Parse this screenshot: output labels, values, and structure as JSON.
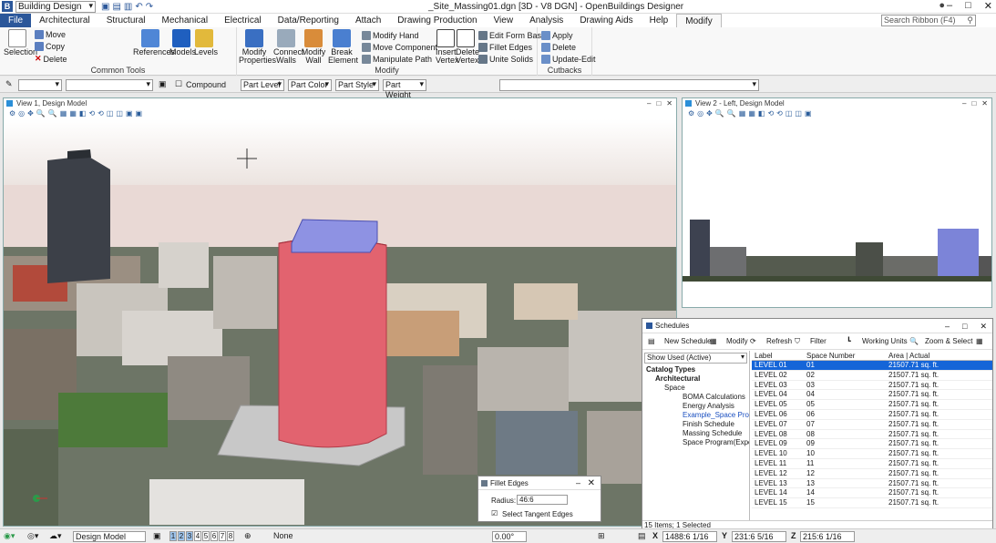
{
  "workspace": "Building Design",
  "title": "_Site_Massing01.dgn [3D - V8 DGN] - OpenBuildings Designer",
  "search_ribbon_placeholder": "Search Ribbon (F4)",
  "tabs": [
    "File",
    "Architectural",
    "Structural",
    "Mechanical",
    "Electrical",
    "Data/Reporting",
    "Attach",
    "Drawing Production",
    "View",
    "Analysis",
    "Drawing Aids",
    "Help",
    "Modify"
  ],
  "ribbon": {
    "common_tools": {
      "label": "Common Tools",
      "selection": "Selection",
      "move": "Move",
      "copy": "Copy",
      "delete": "Delete",
      "references": "References",
      "models": "Models",
      "levels": "Levels"
    },
    "modify": {
      "label": "Modify",
      "modify_properties": "Modify Properties",
      "connect_walls": "Connect Walls",
      "modify_wall": "Modify Wall",
      "break_element": "Break Element",
      "modify_hand": "Modify Hand",
      "move_component": "Move Component",
      "manipulate_path": "Manipulate Path",
      "insert_vertex": "Insert Vertex",
      "delete_vertex": "Delete Vertex",
      "edit_form_base": "Edit Form Base",
      "fillet_edges": "Fillet Edges",
      "unite_solids": "Unite Solids"
    },
    "cutbacks": {
      "label": "Cutbacks",
      "apply": "Apply",
      "delete": "Delete",
      "update_edit": "Update-Edit"
    }
  },
  "attr": {
    "compound": "Compound",
    "part_level": "Part Level",
    "part_color": "Part Color",
    "part_style": "Part Style",
    "part_weight": "Part Weight"
  },
  "view1": {
    "title": "View 1, Design Model"
  },
  "view2": {
    "title": "View 2 - Left, Design Model"
  },
  "schedules": {
    "title": "Schedules",
    "toolbar": {
      "new_schedule": "New Schedule",
      "modify": "Modify",
      "refresh": "Refresh",
      "filter": "Filter",
      "working_units": "Working Units",
      "zoom_select": "Zoom & Select"
    },
    "show_used": "Show Used (Active)",
    "tree": [
      "Catalog Types",
      "Architectural",
      "Space",
      "BOMA Calculations",
      "Energy Analysis",
      "Example_Space Proc",
      "Finish Schedule",
      "Massing Schedule",
      "Space Program(Expo"
    ],
    "columns": {
      "label": "Label",
      "space_number": "Space Number",
      "area": "Area | Actual"
    },
    "rows": [
      {
        "label": "LEVEL 01",
        "num": "01",
        "area": "21507.71 sq. ft."
      },
      {
        "label": "LEVEL 02",
        "num": "02",
        "area": "21507.71 sq. ft."
      },
      {
        "label": "LEVEL 03",
        "num": "03",
        "area": "21507.71 sq. ft."
      },
      {
        "label": "LEVEL 04",
        "num": "04",
        "area": "21507.71 sq. ft."
      },
      {
        "label": "LEVEL 05",
        "num": "05",
        "area": "21507.71 sq. ft."
      },
      {
        "label": "LEVEL 06",
        "num": "06",
        "area": "21507.71 sq. ft."
      },
      {
        "label": "LEVEL 07",
        "num": "07",
        "area": "21507.71 sq. ft."
      },
      {
        "label": "LEVEL 08",
        "num": "08",
        "area": "21507.71 sq. ft."
      },
      {
        "label": "LEVEL 09",
        "num": "09",
        "area": "21507.71 sq. ft."
      },
      {
        "label": "LEVEL 10",
        "num": "10",
        "area": "21507.71 sq. ft."
      },
      {
        "label": "LEVEL 11",
        "num": "11",
        "area": "21507.71 sq. ft."
      },
      {
        "label": "LEVEL 12",
        "num": "12",
        "area": "21507.71 sq. ft."
      },
      {
        "label": "LEVEL 13",
        "num": "13",
        "area": "21507.71 sq. ft."
      },
      {
        "label": "LEVEL 14",
        "num": "14",
        "area": "21507.71 sq. ft."
      },
      {
        "label": "LEVEL 15",
        "num": "15",
        "area": "21507.71 sq. ft."
      }
    ],
    "status": "15 Items; 1 Selected"
  },
  "fillet": {
    "title": "Fillet Edges",
    "radius_label": "Radius:",
    "radius_value": "46:6",
    "tangent_label": "Select Tangent Edges"
  },
  "status": {
    "model": "Design Model",
    "views": [
      "1",
      "2",
      "3",
      "4",
      "5",
      "6",
      "7",
      "8"
    ],
    "none": "None",
    "angle": "0.00°",
    "x_label": "X",
    "x": "1488:6 1/16",
    "y_label": "Y",
    "y": "231:6 5/16",
    "z_label": "Z",
    "z": "215:6 1/16"
  }
}
